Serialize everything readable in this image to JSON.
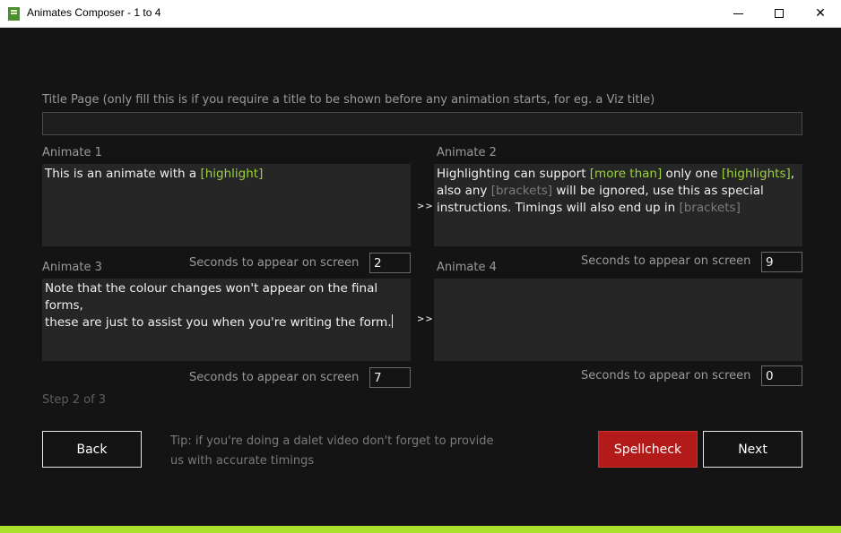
{
  "window": {
    "title": "Animates Composer - 1 to 4",
    "minimize": "–",
    "maximize": "☐",
    "close": "✕"
  },
  "title_page": {
    "label": "Title Page (only fill this is if you require a title to be shown before any animation starts, for eg. a Viz title)",
    "value": ""
  },
  "animate1": {
    "label": "Animate 1",
    "text_parts": [
      "This is an animate with a ",
      "[highlight]"
    ],
    "seconds_label": "Seconds to appear on screen",
    "seconds": "2"
  },
  "animate2": {
    "label": "Animate 2",
    "line1": [
      "Highlighting can support ",
      "[more than]",
      " only one ",
      "[highlights]",
      ","
    ],
    "line2": [
      "also any ",
      "[brackets]",
      " will be ignored, use this as special"
    ],
    "line3": [
      "instructions. Timings will also end up in ",
      "[brackets]"
    ],
    "seconds_label": "Seconds to appear on screen",
    "seconds": "9"
  },
  "animate3": {
    "label": "Animate 3",
    "line1": "Note that the colour changes won't appear on the final forms,",
    "line2": "these are just to assist you when you're writing the form.",
    "seconds_label": "Seconds to appear on screen",
    "seconds": "7"
  },
  "animate4": {
    "label": "Animate 4",
    "text": "",
    "seconds_label": "Seconds to appear on screen",
    "seconds": "0"
  },
  "arrow": ">>",
  "step": "Step 2 of 3",
  "buttons": {
    "back": "Back",
    "spellcheck": "Spellcheck",
    "next": "Next"
  },
  "tip": {
    "line1": "Tip: if you're doing a dalet video don't forget to provide",
    "line2": "us with accurate timings"
  },
  "colors": {
    "highlight": "#9bd23c",
    "bracket": "#7c7c7c",
    "accent_bar": "#a8e02a",
    "spellcheck": "#b31b1b"
  }
}
